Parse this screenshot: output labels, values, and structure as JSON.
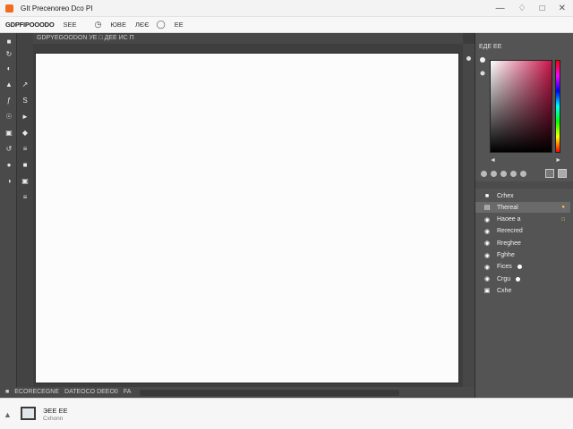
{
  "window": {
    "title": "GIt Precenoreo Dco PI",
    "accent": "#f26a1b",
    "controls": [
      "minimize-icon",
      "bell-icon",
      "maximize-icon",
      "close-icon"
    ]
  },
  "menubar": {
    "doc_name": "GDPFIPOOODO",
    "items": [
      "SEE",
      "ЮВЕ",
      "ЛЄЄ",
      "ЕЕ"
    ],
    "icons": [
      "clock-icon",
      "shape-icon"
    ]
  },
  "document": {
    "tab_label": "GDPYEGOODON  УЕ  □ ДЕЕ ИС П"
  },
  "tools": {
    "left": [
      "■",
      "↻",
      "◐",
      "▲",
      "ƒ",
      "☉",
      "▣",
      "↺",
      "●",
      "◑"
    ],
    "right": [
      "↗",
      "S",
      "►",
      "◆",
      "≡",
      "■",
      "▣",
      "≡"
    ]
  },
  "status": {
    "left": "■",
    "doc_info": "ECORECEGNE",
    "zoom": "DATEOCO DEEO0",
    "mode": "FA"
  },
  "color_panel": {
    "header": "ЕДЕ ЕЕ",
    "foot_left": "◄",
    "foot_right": "►",
    "hue_color": "#c8164a",
    "swatch_labels": [
      "◄",
      "►",
      "■"
    ]
  },
  "layers": [
    {
      "icon": "■",
      "label": "Crhex",
      "selected": false,
      "badge": "",
      "dot": false
    },
    {
      "icon": "▤",
      "label": "Thereal",
      "selected": true,
      "badge": "●",
      "dot": false
    },
    {
      "icon": "◉",
      "label": "Haoee a",
      "selected": false,
      "badge": "□",
      "dot": false
    },
    {
      "icon": "◉",
      "label": "Rerecred",
      "selected": false,
      "badge": "",
      "dot": false
    },
    {
      "icon": "◉",
      "label": "Rreghee",
      "selected": false,
      "badge": "",
      "dot": false
    },
    {
      "icon": "◉",
      "label": "Fghhe",
      "selected": false,
      "badge": "",
      "dot": false
    },
    {
      "icon": "◉",
      "label": "Fices",
      "selected": false,
      "badge": "",
      "dot": true
    },
    {
      "icon": "◉",
      "label": "Crgu",
      "selected": false,
      "badge": "",
      "dot": true
    },
    {
      "icon": "▣",
      "label": "Cxhe",
      "selected": false,
      "badge": "",
      "dot": false
    }
  ],
  "taskbar": {
    "title": "ЭЕЕ ЕЕ",
    "subtitle": "Cxhonn"
  }
}
